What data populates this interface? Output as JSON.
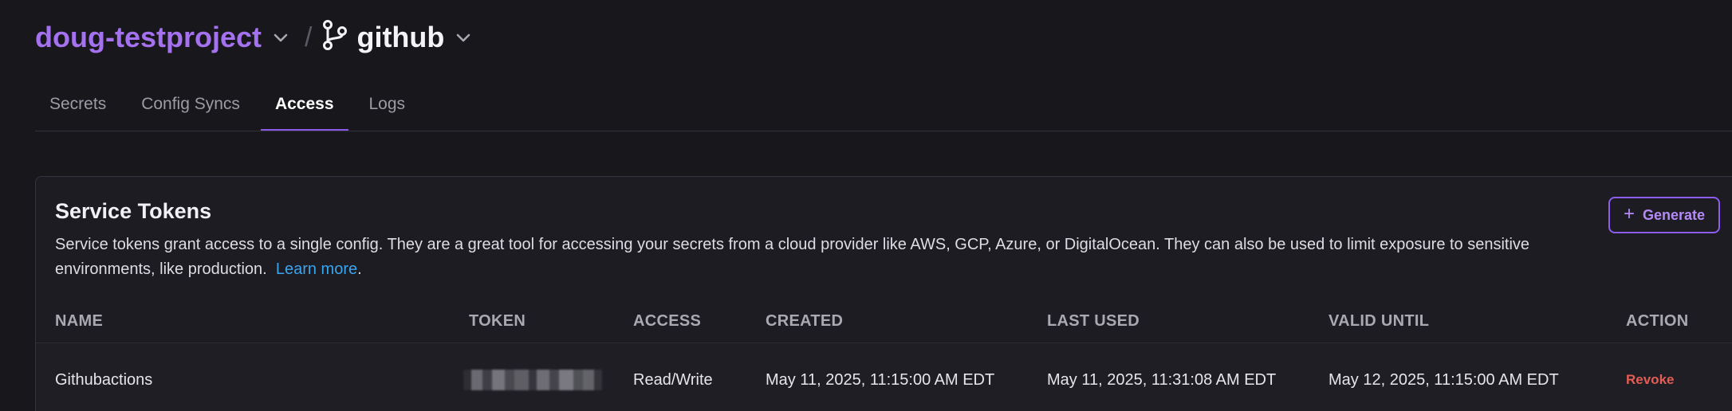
{
  "breadcrumb": {
    "project": "doug-testproject",
    "separator": "/",
    "config": "github",
    "branch_icon": "git-branch-icon",
    "chevron_icon": "chevron-down-icon"
  },
  "tabs": [
    {
      "label": "Secrets",
      "active": false
    },
    {
      "label": "Config Syncs",
      "active": false
    },
    {
      "label": "Access",
      "active": true
    },
    {
      "label": "Logs",
      "active": false
    }
  ],
  "service_tokens": {
    "title": "Service Tokens",
    "description": "Service tokens grant access to a single config. They are a great tool for accessing your secrets from a cloud provider like AWS, GCP, Azure, or DigitalOcean. They can also be used to limit exposure to sensitive environments, like production.",
    "learn_more": "Learn more",
    "learn_more_suffix": ".",
    "generate_label": "Generate",
    "generate_icon": "plus-icon",
    "columns": {
      "name": "NAME",
      "token": "TOKEN",
      "access": "ACCESS",
      "created": "CREATED",
      "last_used": "LAST USED",
      "valid_until": "VALID UNTIL",
      "action": "ACTION"
    },
    "rows": [
      {
        "name": "Githubactions",
        "access": "Read/Write",
        "created": "May 11, 2025, 11:15:00 AM EDT",
        "last_used": "May 11, 2025, 11:31:08 AM EDT",
        "valid_until": "May 12, 2025, 11:15:00 AM EDT",
        "action": "Revoke"
      }
    ]
  },
  "colors": {
    "background": "#18171c",
    "accent": "#a471ef",
    "link": "#3ba4ee",
    "danger": "#e35d55"
  }
}
